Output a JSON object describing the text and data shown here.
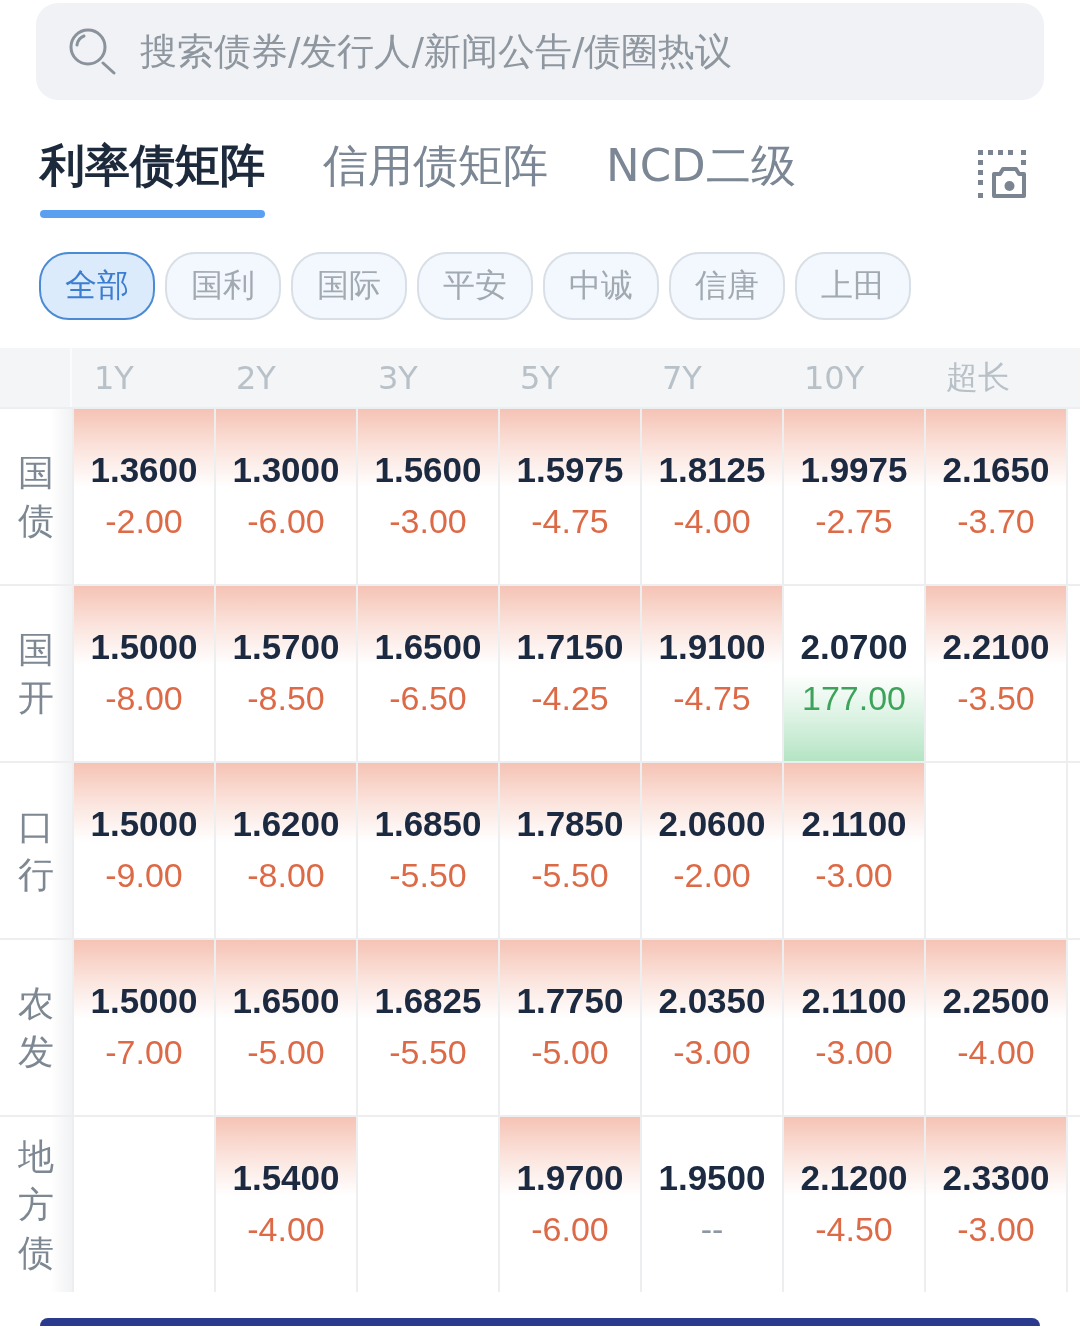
{
  "search": {
    "placeholder": "搜索债券/发行人/新闻公告/债圈热议"
  },
  "tabs": [
    {
      "label": "利率债矩阵",
      "selected": true
    },
    {
      "label": "信用债矩阵",
      "selected": false
    },
    {
      "label": "NCD二级",
      "selected": false
    }
  ],
  "filters": [
    {
      "label": "全部",
      "selected": true
    },
    {
      "label": "国利",
      "selected": false
    },
    {
      "label": "国际",
      "selected": false
    },
    {
      "label": "平安",
      "selected": false
    },
    {
      "label": "中诚",
      "selected": false
    },
    {
      "label": "信唐",
      "selected": false
    },
    {
      "label": "上田",
      "selected": false
    }
  ],
  "matrix": {
    "columns": [
      "1Y",
      "2Y",
      "3Y",
      "5Y",
      "7Y",
      "10Y",
      "超长"
    ],
    "rows": [
      {
        "label": "国债",
        "cells": [
          {
            "kind": "fall",
            "yield": "1.3600",
            "change": "-2.00"
          },
          {
            "kind": "fall",
            "yield": "1.3000",
            "change": "-6.00"
          },
          {
            "kind": "fall",
            "yield": "1.5600",
            "change": "-3.00"
          },
          {
            "kind": "fall",
            "yield": "1.5975",
            "change": "-4.75"
          },
          {
            "kind": "fall",
            "yield": "1.8125",
            "change": "-4.00"
          },
          {
            "kind": "fall",
            "yield": "1.9975",
            "change": "-2.75"
          },
          {
            "kind": "fall",
            "yield": "2.1650",
            "change": "-3.70"
          }
        ]
      },
      {
        "label": "国开",
        "cells": [
          {
            "kind": "fall",
            "yield": "1.5000",
            "change": "-8.00"
          },
          {
            "kind": "fall",
            "yield": "1.5700",
            "change": "-8.50"
          },
          {
            "kind": "fall",
            "yield": "1.6500",
            "change": "-6.50"
          },
          {
            "kind": "fall",
            "yield": "1.7150",
            "change": "-4.25"
          },
          {
            "kind": "fall",
            "yield": "1.9100",
            "change": "-4.75"
          },
          {
            "kind": "rise",
            "yield": "2.0700",
            "change": "177.00"
          },
          {
            "kind": "fall",
            "yield": "2.2100",
            "change": "-3.50"
          }
        ]
      },
      {
        "label": "口行",
        "cells": [
          {
            "kind": "fall",
            "yield": "1.5000",
            "change": "-9.00"
          },
          {
            "kind": "fall",
            "yield": "1.6200",
            "change": "-8.00"
          },
          {
            "kind": "fall",
            "yield": "1.6850",
            "change": "-5.50"
          },
          {
            "kind": "fall",
            "yield": "1.7850",
            "change": "-5.50"
          },
          {
            "kind": "fall",
            "yield": "2.0600",
            "change": "-2.00"
          },
          {
            "kind": "fall",
            "yield": "2.1100",
            "change": "-3.00"
          },
          {
            "kind": "empty"
          }
        ]
      },
      {
        "label": "农发",
        "cells": [
          {
            "kind": "fall",
            "yield": "1.5000",
            "change": "-7.00"
          },
          {
            "kind": "fall",
            "yield": "1.6500",
            "change": "-5.00"
          },
          {
            "kind": "fall",
            "yield": "1.6825",
            "change": "-5.50"
          },
          {
            "kind": "fall",
            "yield": "1.7750",
            "change": "-5.00"
          },
          {
            "kind": "fall",
            "yield": "2.0350",
            "change": "-3.00"
          },
          {
            "kind": "fall",
            "yield": "2.1100",
            "change": "-3.00"
          },
          {
            "kind": "fall",
            "yield": "2.2500",
            "change": "-4.00"
          }
        ]
      },
      {
        "label": "地方债",
        "cells": [
          {
            "kind": "empty"
          },
          {
            "kind": "fall",
            "yield": "1.5400",
            "change": "-4.00"
          },
          {
            "kind": "empty"
          },
          {
            "kind": "fall",
            "yield": "1.9700",
            "change": "-6.00"
          },
          {
            "kind": "flat",
            "yield": "1.9500",
            "change": "--"
          },
          {
            "kind": "fall",
            "yield": "2.1200",
            "change": "-4.50"
          },
          {
            "kind": "fall",
            "yield": "2.3300",
            "change": "-3.00"
          }
        ]
      }
    ]
  }
}
